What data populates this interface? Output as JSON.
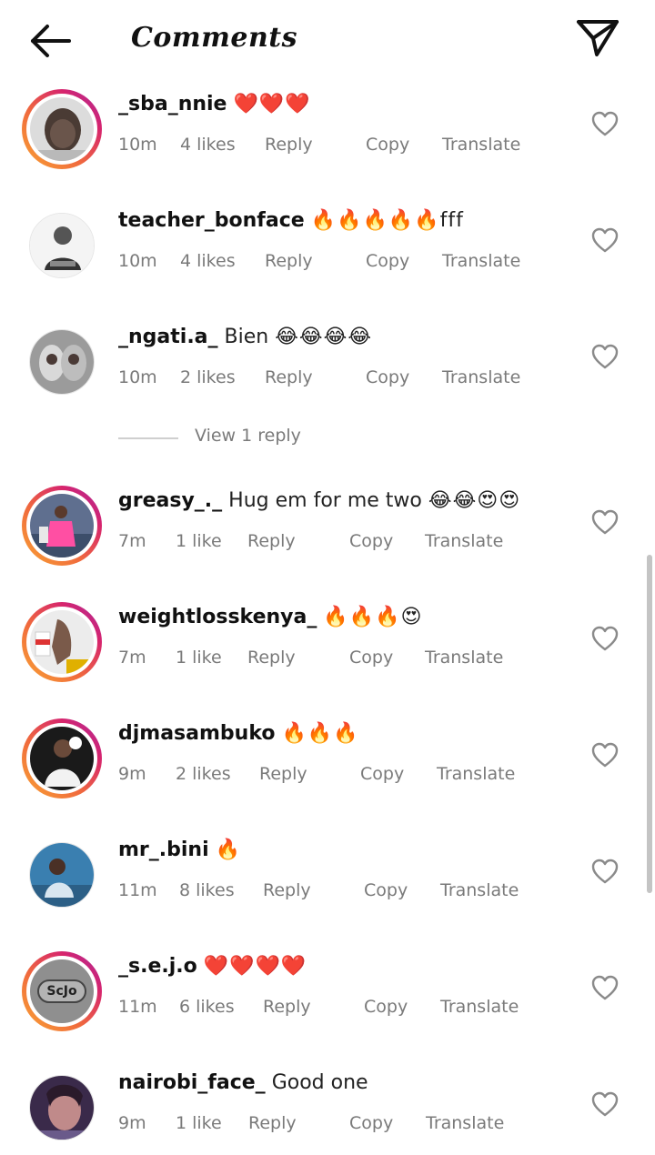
{
  "header": {
    "title": "Comments",
    "back_icon": "arrow-left-icon",
    "send_icon": "paper-plane-icon"
  },
  "actions": {
    "reply": "Reply",
    "copy": "Copy",
    "translate": "Translate"
  },
  "colors": {
    "story_ring": [
      "#f9a534",
      "#f06a3d",
      "#d6246e",
      "#a62ca0"
    ],
    "meta_text": "#7a7a7a",
    "heart_outline": "#8a8a8a"
  },
  "comments": [
    {
      "username": "_sba_nnie",
      "text": "",
      "emojis": "❤️❤️❤️",
      "time": "10m",
      "likes": "4 likes",
      "story_ring": true
    },
    {
      "username": "teacher_bonface",
      "text": "",
      "emojis": "🔥🔥🔥🔥🔥fff",
      "time": "10m",
      "likes": "4 likes",
      "story_ring": false
    },
    {
      "username": "_ngati.a_",
      "text": "Bien",
      "emojis": "😂😂😂😂",
      "time": "10m",
      "likes": "2 likes",
      "story_ring": false
    },
    {
      "username": "greasy_._",
      "text": "Hug em for me two",
      "emojis": "😂😂😍😍",
      "time": "7m",
      "likes": "1 like",
      "story_ring": true
    },
    {
      "username": "weightlosskenya_",
      "text": "",
      "emojis": "🔥🔥🔥😍",
      "time": "7m",
      "likes": "1 like",
      "story_ring": true
    },
    {
      "username": "djmasambuko",
      "text": "",
      "emojis": "🔥🔥🔥",
      "time": "9m",
      "likes": "2 likes",
      "story_ring": true
    },
    {
      "username": "mr_.bini",
      "text": "",
      "emojis": "🔥",
      "time": "11m",
      "likes": "8 likes",
      "story_ring": false
    },
    {
      "username": "_s.e.j.o",
      "text": "",
      "emojis": "❤️❤️❤️❤️",
      "time": "11m",
      "likes": "6 likes",
      "story_ring": true
    },
    {
      "username": "nairobi_face_",
      "text": "Good one",
      "emojis": "",
      "time": "9m",
      "likes": "1 like",
      "story_ring": false
    }
  ],
  "view_replies": {
    "label": "View 1 reply"
  },
  "avatar_badges": {
    "sejo": "ScJo"
  }
}
